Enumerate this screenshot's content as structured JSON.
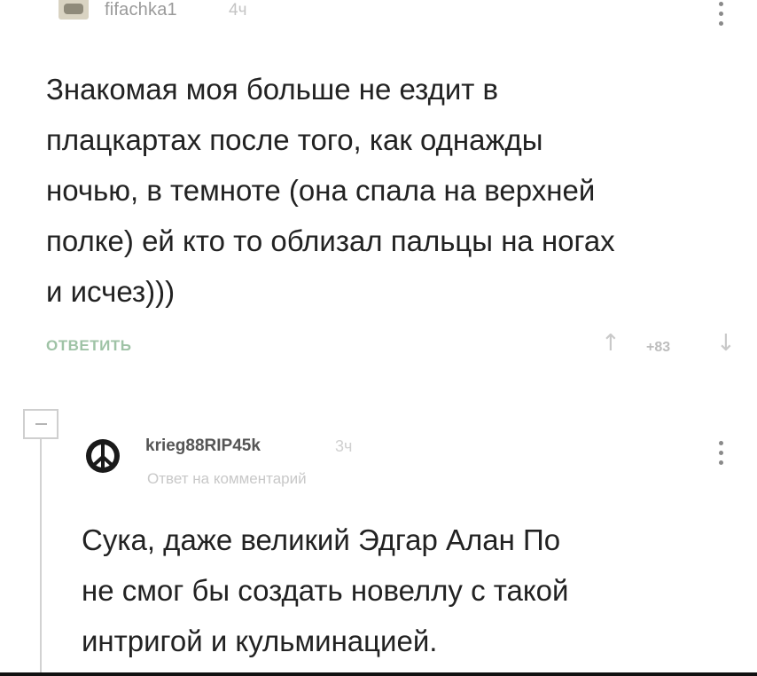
{
  "comment": {
    "author": "fifachka1",
    "time": "4ч",
    "text": "Знакомая моя больше не ездит в\nплацкартах после того, как однажды\nночью, в темноте (она спала на верхней\nполке) ей кто то облизал пальцы на ногах\nи исчез)))",
    "reply_label": "ОТВЕТИТЬ",
    "rating": "+83",
    "vote_up_icon": "arrow-up-icon",
    "vote_down_icon": "arrow-down-icon"
  },
  "reply": {
    "author": "krieg88RIP45k",
    "time": "3ч",
    "reply_to": "Ответ на комментарий",
    "text": "Сука, даже великий Эдгар Алан По\nне смог бы создать новеллу с такой\nинтригой и кульминацией."
  },
  "colors": {
    "reply_button": "#9fc3a6",
    "muted": "#c8c8c8",
    "text": "#222222"
  }
}
